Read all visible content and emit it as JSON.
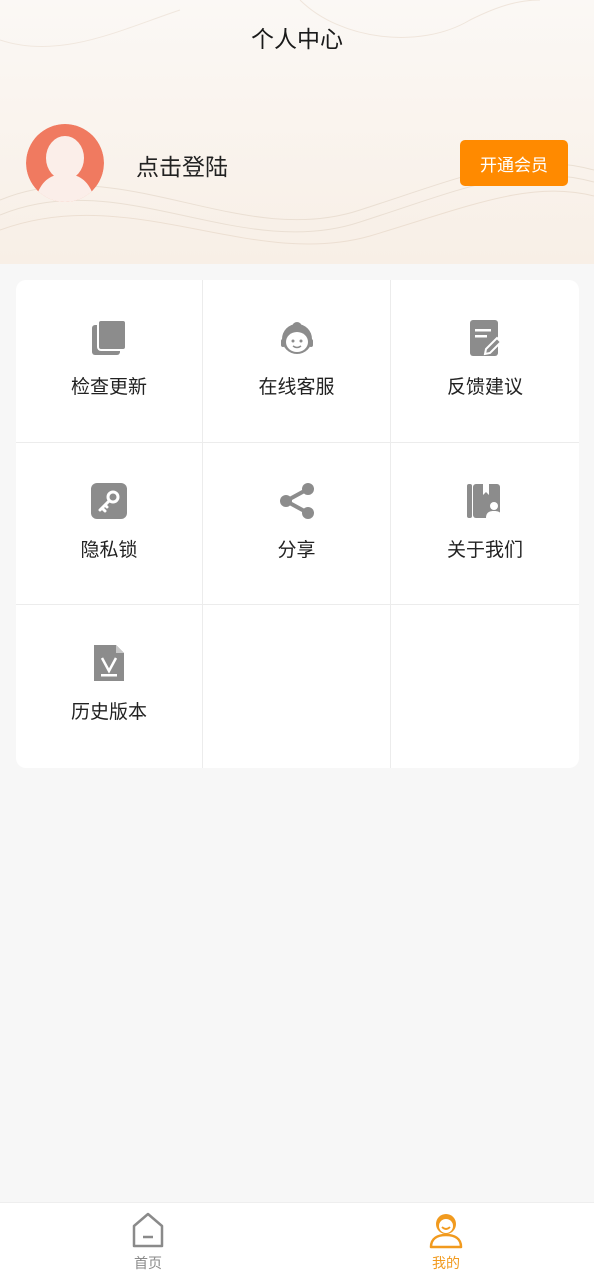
{
  "header": {
    "title": "个人中心",
    "login_text": "点击登陆",
    "vip_button": "开通会员"
  },
  "colors": {
    "accent": "#ff8a00",
    "avatar": "#f07a60",
    "icon_gray": "#8c8c8c",
    "tab_active": "#f19a1e",
    "tab_inactive": "#8a8a8a"
  },
  "menu": {
    "items": [
      {
        "label": "检查更新",
        "icon": "copy-stack-icon"
      },
      {
        "label": "在线客服",
        "icon": "customer-service-icon"
      },
      {
        "label": "反馈建议",
        "icon": "feedback-edit-icon"
      },
      {
        "label": "隐私锁",
        "icon": "key-lock-icon"
      },
      {
        "label": "分享",
        "icon": "share-icon"
      },
      {
        "label": "关于我们",
        "icon": "about-book-icon"
      },
      {
        "label": "历史版本",
        "icon": "version-file-icon"
      }
    ]
  },
  "tabbar": {
    "home": "首页",
    "mine": "我的"
  }
}
